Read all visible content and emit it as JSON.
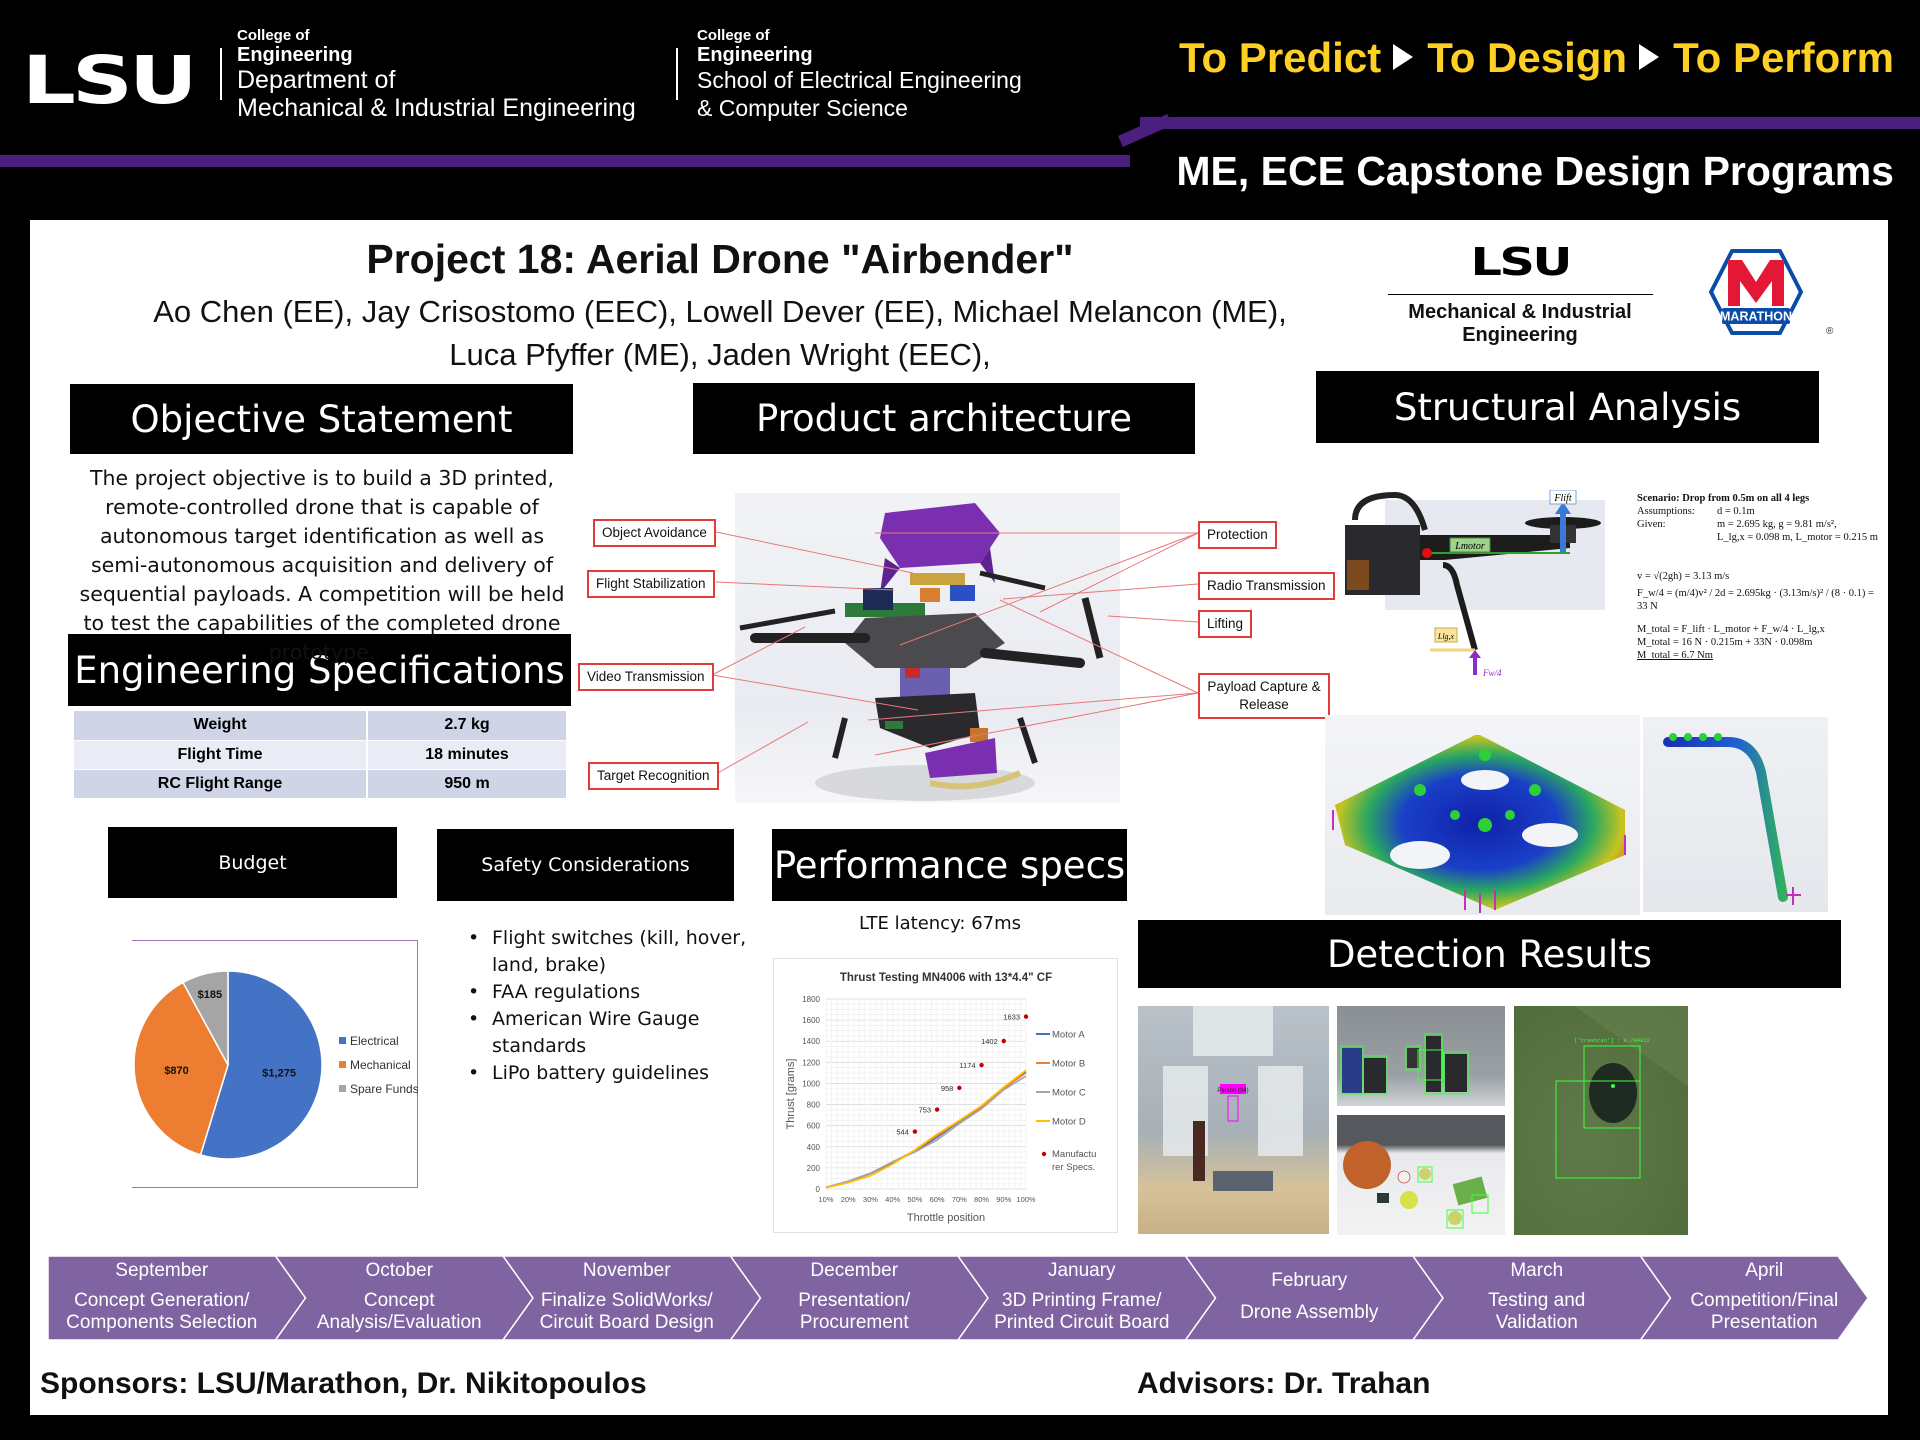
{
  "header": {
    "logo_text": "LSU",
    "blocks": [
      {
        "college": "College of",
        "engineering": "Engineering",
        "dept_line1": "Department of",
        "dept_line2": "Mechanical & Industrial Engineering"
      },
      {
        "college": "College of",
        "engineering": "Engineering",
        "dept_line1": "School of Electrical Engineering",
        "dept_line2": "& Computer Science"
      }
    ],
    "tagline": [
      "To Predict",
      "To Design",
      "To Perform"
    ],
    "programs": "ME, ECE Capstone Design Programs",
    "colors": {
      "purple": "#4b1f80",
      "gold": "#fdd023"
    }
  },
  "project": {
    "title": "Project 18: Aerial Drone \"Airbender\"",
    "authors_line1": "Ao Chen (EE), Jay Crisostomo (EEC), Lowell Dever (EE), Michael Melancon (ME),",
    "authors_line2": "Luca Pfyffer (ME), Jaden Wright (EEC),"
  },
  "logos": {
    "lsu_mie": {
      "lsu": "LSU",
      "line1": "Mechanical & Industrial",
      "line2": "Engineering"
    },
    "marathon": {
      "text": "MARATHON",
      "letter": "M",
      "reg": "®",
      "red": "#e31837",
      "blue": "#0a4ca8"
    }
  },
  "sections": {
    "objective": "Objective Statement",
    "product_architecture": "Product architecture",
    "structural": "Structural Analysis",
    "specs": "Engineering Specifications",
    "budget": "Budget",
    "safety": "Safety Considerations",
    "performance": "Performance specs",
    "detection": "Detection Results"
  },
  "objective_text": "The project objective is to build a 3D printed, remote-controlled drone that is capable of autonomous target identification as well as semi-autonomous acquisition and delivery of sequential payloads. A competition will be held to test the capabilities of the completed drone prototype.",
  "specs": [
    {
      "label": "Weight",
      "value": "2.7 kg"
    },
    {
      "label": "Flight Time",
      "value": "18 minutes"
    },
    {
      "label": "RC Flight Range",
      "value": "950 m"
    }
  ],
  "architecture_callouts": {
    "left": [
      "Object Avoidance",
      "Flight Stabilization",
      "Video Transmission",
      "Target Recognition"
    ],
    "right": [
      "Protection",
      "Radio Transmission",
      "Lifting",
      "Payload Capture & Release"
    ]
  },
  "structural": {
    "labels": {
      "f_lift": "F_lift",
      "l_motor": "L_motor",
      "l_lgx": "L_lg,x",
      "f_w4": "F_w/4"
    },
    "scenario": "Scenario: Drop from 0.5m on all 4 legs",
    "assumptions_label": "Assumptions:",
    "assumptions": "d = 0.1m",
    "given_label": "Given:",
    "given_1": "m = 2.695 kg, g = 9.81 m/s²,",
    "given_2": "L_lg,x = 0.098 m, L_motor = 0.215 m",
    "eq_v": "v = √(2gh) = 3.13 m/s",
    "eq_f": "F_w/4 = (m/4)v² / 2d = 2.695kg · (3.13m/s)² / (8 · 0.1) = 33 N",
    "eq_m1": "M_total = F_lift · L_motor + F_w/4 · L_lg,x",
    "eq_m2": "M_total = 16 N · 0.215m + 33N · 0.098m",
    "eq_m3": "M_total = 6.7 Nm"
  },
  "safety_items": [
    "Flight switches (kill, hover, land, brake)",
    "FAA regulations",
    "American Wire Gauge standards",
    "LiPo battery guidelines"
  ],
  "performance": {
    "lte": "LTE latency: 67ms"
  },
  "detection": {
    "label_person": "Person (94)",
    "label_trash": "['trashcan'] : 0.794922"
  },
  "chart_data": [
    {
      "type": "pie",
      "title": "Budget",
      "categories": [
        "Electrical",
        "Mechanical",
        "Spare Funds"
      ],
      "values": [
        1275,
        870,
        185
      ],
      "labels": [
        "$1,275",
        "$870",
        "$185"
      ],
      "colors": [
        "#4472c4",
        "#ed7d31",
        "#a5a5a5"
      ],
      "legend": "right"
    },
    {
      "type": "line",
      "title": "Thrust Testing MN4006 with 13*4.4\" CF",
      "xlabel": "Throttle position",
      "ylabel": "Thrust [grams]",
      "x": [
        "10%",
        "20%",
        "30%",
        "40%",
        "50%",
        "60%",
        "70%",
        "80%",
        "90%",
        "100%"
      ],
      "ylim": [
        0,
        1800
      ],
      "yticks": [
        0,
        200,
        400,
        600,
        800,
        1000,
        1200,
        1400,
        1600,
        1800
      ],
      "grid": true,
      "legend": "right",
      "series": [
        {
          "name": "Motor A",
          "color": "#4472c4",
          "values": [
            15,
            70,
            145,
            250,
            355,
            490,
            640,
            775,
            950,
            1110
          ]
        },
        {
          "name": "Motor B",
          "color": "#ed7d31",
          "values": [
            15,
            72,
            148,
            255,
            365,
            505,
            645,
            780,
            955,
            1100
          ]
        },
        {
          "name": "Motor C",
          "color": "#a5a5a5",
          "values": [
            15,
            75,
            150,
            258,
            350,
            465,
            620,
            760,
            940,
            1070
          ]
        },
        {
          "name": "Motor D",
          "color": "#ffc000",
          "values": [
            12,
            60,
            125,
            235,
            370,
            520,
            650,
            790,
            965,
            1125
          ]
        }
      ],
      "points": {
        "name": "Manufacturer Specs.",
        "color": "#c00000",
        "x": [
          "50%",
          "60%",
          "70%",
          "80%",
          "90%",
          "100%"
        ],
        "values": [
          544,
          753,
          958,
          1174,
          1402,
          1633
        ]
      }
    }
  ],
  "timeline": [
    {
      "month": "September",
      "task_1": "Concept Generation/",
      "task_2": "Components Selection"
    },
    {
      "month": "October",
      "task_1": "Concept",
      "task_2": "Analysis/Evaluation"
    },
    {
      "month": "November",
      "task_1": "Finalize SolidWorks/",
      "task_2": "Circuit Board Design"
    },
    {
      "month": "December",
      "task_1": "Presentation/",
      "task_2": "Procurement"
    },
    {
      "month": "January",
      "task_1": "3D Printing Frame/",
      "task_2": "Printed Circuit Board"
    },
    {
      "month": "February",
      "task_1": "Drone Assembly",
      "task_2": ""
    },
    {
      "month": "March",
      "task_1": "Testing and",
      "task_2": "Validation"
    },
    {
      "month": "April",
      "task_1": "Competition/Final",
      "task_2": "Presentation"
    }
  ],
  "timeline_color": "#8064a2",
  "footer": {
    "sponsors": "Sponsors: LSU/Marathon, Dr. Nikitopoulos",
    "advisors": "Advisors: Dr. Trahan"
  }
}
